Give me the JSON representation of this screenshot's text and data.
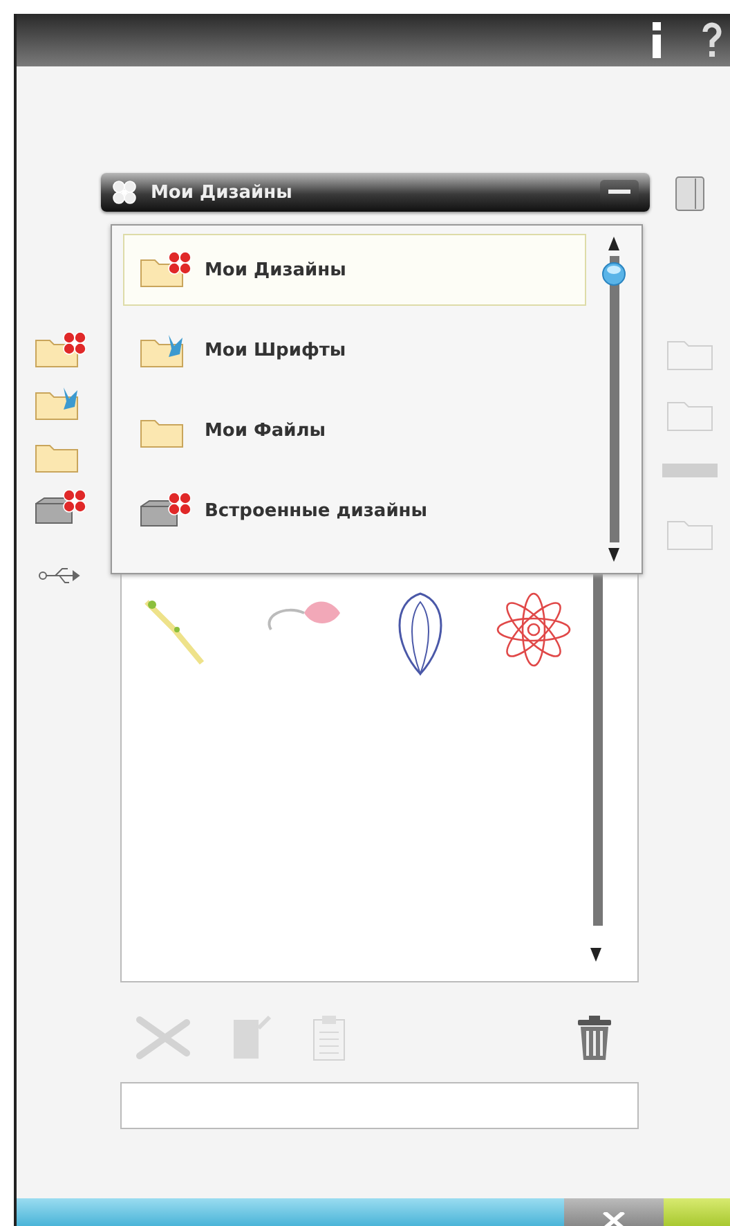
{
  "folder_selector": {
    "title": "Мои Дизайны",
    "expanded": true,
    "items": [
      {
        "kind": "designs",
        "label": "Мои Дизайны",
        "selected": true
      },
      {
        "kind": "fonts",
        "label": "Мои Шрифты",
        "selected": false
      },
      {
        "kind": "files",
        "label": "Мои Файлы",
        "selected": false
      },
      {
        "kind": "builtin",
        "label": "Встроенные дизайны",
        "selected": false
      }
    ]
  },
  "sidebar": {
    "items": [
      {
        "kind": "designs",
        "selected": false
      },
      {
        "kind": "fonts",
        "selected": false
      },
      {
        "kind": "files",
        "selected": false
      },
      {
        "kind": "builtin",
        "selected": false
      },
      {
        "kind": "usb",
        "selected": false
      }
    ]
  },
  "toolbar": [
    {
      "kind": "cut",
      "disabled": true
    },
    {
      "kind": "copy",
      "disabled": true
    },
    {
      "kind": "paste",
      "disabled": true
    },
    {
      "kind": "delete",
      "disabled": false
    }
  ]
}
